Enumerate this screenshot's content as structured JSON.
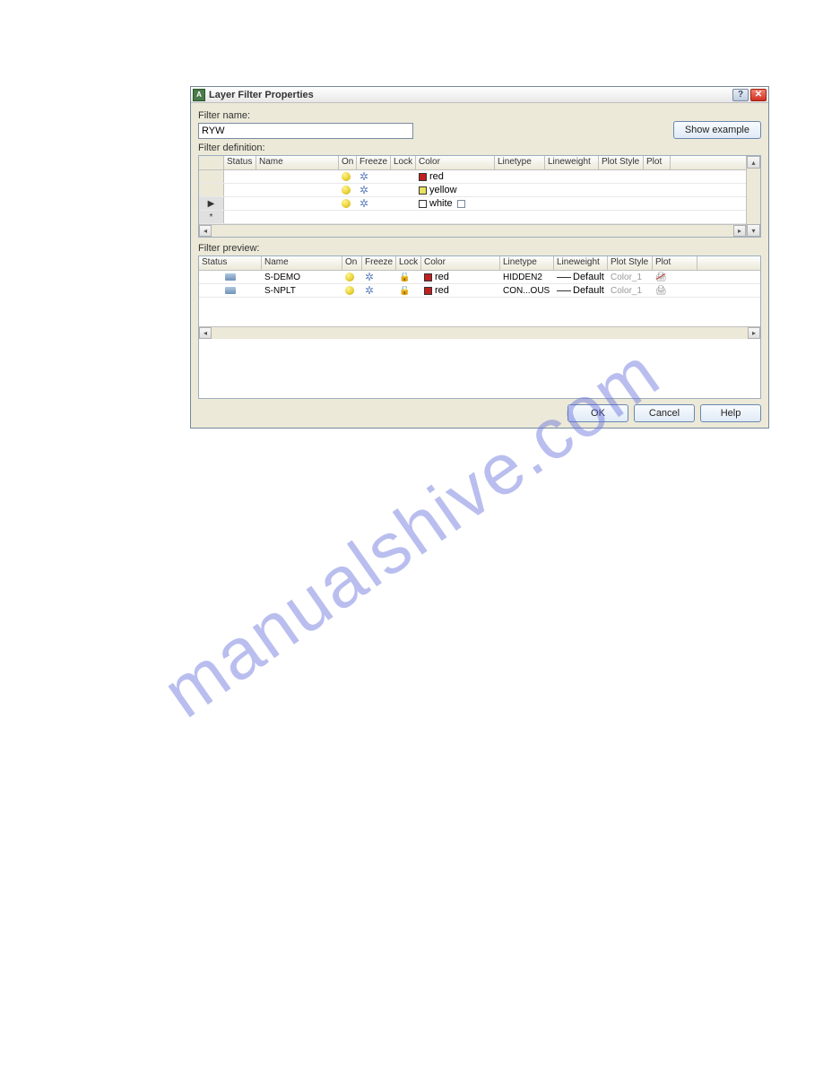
{
  "watermark": "manualshive.com",
  "title": "Layer Filter Properties",
  "labels": {
    "filter_name": "Filter name:",
    "filter_def": "Filter definition:",
    "filter_preview": "Filter preview:"
  },
  "filter_name_value": "RYW",
  "buttons": {
    "show_example": "Show example",
    "ok": "OK",
    "cancel": "Cancel",
    "help": "Help"
  },
  "def_headers": [
    "Status",
    "Name",
    "On",
    "Freeze",
    "Lock",
    "Color",
    "Linetype",
    "Lineweight",
    "Plot Style",
    "Plot"
  ],
  "def_rows": [
    {
      "color_name": "red",
      "swatch": "red"
    },
    {
      "color_name": "yellow",
      "swatch": "yellow"
    },
    {
      "color_name": "white",
      "swatch": "white",
      "selector": true
    }
  ],
  "preview_headers": [
    "Status",
    "Name",
    "On",
    "Freeze",
    "Lock",
    "Color",
    "Linetype",
    "Lineweight",
    "Plot Style",
    "Plot"
  ],
  "preview_rows": [
    {
      "name": "S-DEMO",
      "color": "red",
      "linetype": "HIDDEN2",
      "lineweight": "Default",
      "plotstyle": "Color_1",
      "plot": "no"
    },
    {
      "name": "S-NPLT",
      "color": "red",
      "linetype": "CON...OUS",
      "lineweight": "Default",
      "plotstyle": "Color_1",
      "plot": "yes"
    }
  ]
}
